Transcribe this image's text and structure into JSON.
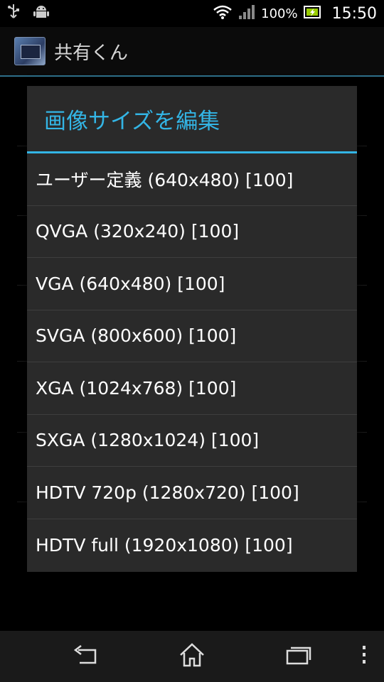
{
  "status_bar": {
    "battery_percent": "100%",
    "time": "15:50",
    "icons": [
      "usb-icon",
      "android-debug-icon",
      "wifi-icon",
      "signal-icon",
      "battery-charging-icon"
    ]
  },
  "app": {
    "title": "共有くん"
  },
  "dialog": {
    "title": "画像サイズを編集",
    "options": [
      "ユーザー定義 (640x480) [100]",
      "QVGA (320x240) [100]",
      "VGA (640x480) [100]",
      "SVGA (800x600) [100]",
      "XGA (1024x768) [100]",
      "SXGA (1280x1024) [100]",
      "HDTV 720p (1280x720) [100]",
      "HDTV full (1920x1080) [100]"
    ]
  },
  "nav_bar": {
    "icons": [
      "back-icon",
      "home-icon",
      "recent-apps-icon",
      "menu-icon"
    ]
  },
  "colors": {
    "accent": "#33b5e5",
    "dialog_bg": "#2a2a2a",
    "divider": "#3e3e3e"
  }
}
